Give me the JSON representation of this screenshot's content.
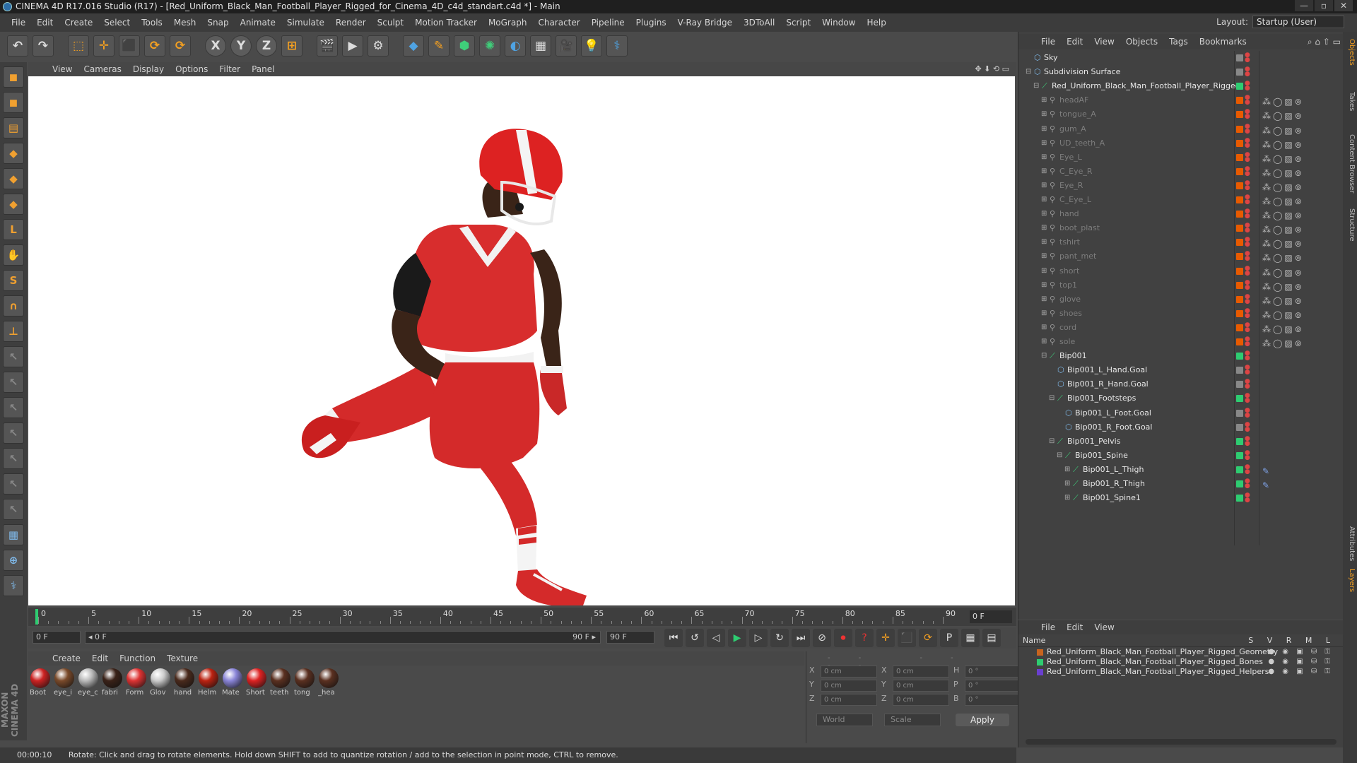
{
  "window": {
    "title": "CINEMA 4D R17.016 Studio (R17) - [Red_Uniform_Black_Man_Football_Player_Rigged_for_Cinema_4D_c4d_standart.c4d *] - Main",
    "min": "—",
    "max": "▫",
    "close": "✕"
  },
  "menubar": [
    "File",
    "Edit",
    "Create",
    "Select",
    "Tools",
    "Mesh",
    "Snap",
    "Animate",
    "Simulate",
    "Render",
    "Sculpt",
    "Motion Tracker",
    "MoGraph",
    "Character",
    "Pipeline",
    "Plugins",
    "V-Ray Bridge",
    "3DToAll",
    "Script",
    "Window",
    "Help"
  ],
  "layout": {
    "label": "Layout:",
    "value": "Startup (User)"
  },
  "toolbar": {
    "undo": "↶",
    "redo": "↷",
    "select": "⬚",
    "move": "✛",
    "scale": "⬛",
    "rotate": "⟳",
    "rotate2": "⟳",
    "x": "X",
    "y": "Y",
    "z": "Z",
    "coord": "⊞",
    "render1": "🎬",
    "render2": "▶",
    "render3": "⚙",
    "cube": "◆",
    "pen": "✎",
    "nurbs": "⬢",
    "array": "✺",
    "deformer": "◐",
    "floor": "▦",
    "camera": "🎥",
    "light": "💡",
    "python": "⚕"
  },
  "lefttools": [
    "◼",
    "◼",
    "▤",
    "◆",
    "◆",
    "◆",
    "L",
    "✋",
    "S",
    "∩",
    "⊥",
    "↖",
    "↖",
    "↖",
    "↖",
    "↖",
    "↖",
    "↖",
    "▦",
    "⊕",
    "⚕"
  ],
  "brand": "MAXON CINEMA 4D",
  "viewport_menu": [
    "View",
    "Cameras",
    "Display",
    "Options",
    "Filter",
    "Panel"
  ],
  "viewport_icons": "✥ ⬇ ⟲ ▭",
  "timeline": {
    "ticks": [
      "0",
      "5",
      "10",
      "15",
      "20",
      "25",
      "30",
      "35",
      "40",
      "45",
      "50",
      "55",
      "60",
      "65",
      "70",
      "75",
      "80",
      "85",
      "90"
    ],
    "frame_end": "0 F"
  },
  "transport": {
    "cur_frame": "0 F",
    "range_start": "◂ 0 F",
    "range_end": "90 F ▸",
    "end_frame": "90 F",
    "buttons": [
      "⏮",
      "↺",
      "◁",
      "▶",
      "▷",
      "↻",
      "⏭",
      "⊘",
      "⏺",
      "?",
      "✛",
      "⬛",
      "⟳",
      "P",
      "▦",
      "▤"
    ]
  },
  "material_menu": [
    "Create",
    "Edit",
    "Function",
    "Texture"
  ],
  "materials": [
    {
      "name": "Boot",
      "color": "#c22"
    },
    {
      "name": "eye_i",
      "color": "#7a4a2a"
    },
    {
      "name": "eye_c",
      "color": "#bbb"
    },
    {
      "name": "fabri",
      "color": "#3a2218"
    },
    {
      "name": "Form",
      "color": "#d33"
    },
    {
      "name": "Glov",
      "color": "#ccc"
    },
    {
      "name": "hand",
      "color": "#4a2a1c"
    },
    {
      "name": "Helm",
      "color": "#b21"
    },
    {
      "name": "Mate",
      "color": "#8a85d8"
    },
    {
      "name": "Short",
      "color": "#d22"
    },
    {
      "name": "teeth",
      "color": "#5a3020"
    },
    {
      "name": "tong",
      "color": "#5a3020"
    },
    {
      "name": "_hea",
      "color": "#5a3020"
    }
  ],
  "coords": {
    "header": "-- -- --",
    "rows": [
      {
        "a": "X",
        "av": "0 cm",
        "b": "X",
        "bv": "0 cm",
        "c": "H",
        "cv": "0 °"
      },
      {
        "a": "Y",
        "av": "0 cm",
        "b": "Y",
        "bv": "0 cm",
        "c": "P",
        "cv": "0 °"
      },
      {
        "a": "Z",
        "av": "0 cm",
        "b": "Z",
        "bv": "0 cm",
        "c": "B",
        "cv": "0 °"
      }
    ],
    "mode1": "World",
    "mode2": "Scale",
    "apply": "Apply"
  },
  "status": {
    "time": "00:00:10",
    "text": "Rotate: Click and drag to rotate elements. Hold down SHIFT to add to quantize rotation / add to the selection in point mode, CTRL to remove."
  },
  "object_menu": [
    "File",
    "Edit",
    "View",
    "Objects",
    "Tags",
    "Bookmarks"
  ],
  "object_icons": "⌕ ⌂ ⇧ ▭",
  "objects": [
    {
      "name": "Sky",
      "depth": 0,
      "dim": false,
      "tag": "#888",
      "exp": ""
    },
    {
      "name": "Subdivision Surface",
      "depth": 0,
      "dim": false,
      "tag": "#888",
      "exp": "⊟"
    },
    {
      "name": "Red_Uniform_Black_Man_Football_Player_Rigged",
      "depth": 1,
      "dim": false,
      "tag": "#2ecc71",
      "exp": "⊟"
    },
    {
      "name": "headAF",
      "depth": 2,
      "dim": true,
      "tag": "#e85a00",
      "exp": "⊞"
    },
    {
      "name": "tongue_A",
      "depth": 2,
      "dim": true,
      "tag": "#e85a00",
      "exp": "⊞"
    },
    {
      "name": "gum_A",
      "depth": 2,
      "dim": true,
      "tag": "#e85a00",
      "exp": "⊞"
    },
    {
      "name": "UD_teeth_A",
      "depth": 2,
      "dim": true,
      "tag": "#e85a00",
      "exp": "⊞"
    },
    {
      "name": "Eye_L",
      "depth": 2,
      "dim": true,
      "tag": "#e85a00",
      "exp": "⊞"
    },
    {
      "name": "C_Eye_R",
      "depth": 2,
      "dim": true,
      "tag": "#e85a00",
      "exp": "⊞"
    },
    {
      "name": "Eye_R",
      "depth": 2,
      "dim": true,
      "tag": "#e85a00",
      "exp": "⊞"
    },
    {
      "name": "C_Eye_L",
      "depth": 2,
      "dim": true,
      "tag": "#e85a00",
      "exp": "⊞"
    },
    {
      "name": "hand",
      "depth": 2,
      "dim": true,
      "tag": "#e85a00",
      "exp": "⊞"
    },
    {
      "name": "boot_plast",
      "depth": 2,
      "dim": true,
      "tag": "#e85a00",
      "exp": "⊞"
    },
    {
      "name": "tshirt",
      "depth": 2,
      "dim": true,
      "tag": "#e85a00",
      "exp": "⊞"
    },
    {
      "name": "pant_met",
      "depth": 2,
      "dim": true,
      "tag": "#e85a00",
      "exp": "⊞"
    },
    {
      "name": "short",
      "depth": 2,
      "dim": true,
      "tag": "#e85a00",
      "exp": "⊞"
    },
    {
      "name": "top1",
      "depth": 2,
      "dim": true,
      "tag": "#e85a00",
      "exp": "⊞"
    },
    {
      "name": "glove",
      "depth": 2,
      "dim": true,
      "tag": "#e85a00",
      "exp": "⊞"
    },
    {
      "name": "shoes",
      "depth": 2,
      "dim": true,
      "tag": "#e85a00",
      "exp": "⊞"
    },
    {
      "name": "cord",
      "depth": 2,
      "dim": true,
      "tag": "#e85a00",
      "exp": "⊞"
    },
    {
      "name": "sole",
      "depth": 2,
      "dim": true,
      "tag": "#e85a00",
      "exp": "⊞"
    },
    {
      "name": "Bip001",
      "depth": 2,
      "dim": false,
      "tag": "#2ecc71",
      "exp": "⊟"
    },
    {
      "name": "Bip001_L_Hand.Goal",
      "depth": 3,
      "dim": false,
      "tag": "#888",
      "exp": ""
    },
    {
      "name": "Bip001_R_Hand.Goal",
      "depth": 3,
      "dim": false,
      "tag": "#888",
      "exp": ""
    },
    {
      "name": "Bip001_Footsteps",
      "depth": 3,
      "dim": false,
      "tag": "#2ecc71",
      "exp": "⊟"
    },
    {
      "name": "Bip001_L_Foot.Goal",
      "depth": 4,
      "dim": false,
      "tag": "#888",
      "exp": ""
    },
    {
      "name": "Bip001_R_Foot.Goal",
      "depth": 4,
      "dim": false,
      "tag": "#888",
      "exp": ""
    },
    {
      "name": "Bip001_Pelvis",
      "depth": 3,
      "dim": false,
      "tag": "#2ecc71",
      "exp": "⊟"
    },
    {
      "name": "Bip001_Spine",
      "depth": 4,
      "dim": false,
      "tag": "#2ecc71",
      "exp": "⊟"
    },
    {
      "name": "Bip001_L_Thigh",
      "depth": 5,
      "dim": false,
      "tag": "#2ecc71",
      "exp": "⊞"
    },
    {
      "name": "Bip001_R_Thigh",
      "depth": 5,
      "dim": false,
      "tag": "#2ecc71",
      "exp": "⊞"
    },
    {
      "name": "Bip001_Spine1",
      "depth": 5,
      "dim": false,
      "tag": "#2ecc71",
      "exp": "⊞"
    }
  ],
  "side_tabs": [
    "Objects",
    "Takes",
    "Content Browser",
    "Structure",
    "Attributes",
    "Layers"
  ],
  "layer_menu": [
    "File",
    "Edit",
    "View"
  ],
  "layer_header": {
    "name": "Name",
    "cols": "S V R M L"
  },
  "layers": [
    {
      "name": "Red_Uniform_Black_Man_Football_Player_Rigged_Geometry",
      "color": "#c8641e"
    },
    {
      "name": "Red_Uniform_Black_Man_Football_Player_Rigged_Bones",
      "color": "#2ecc71"
    },
    {
      "name": "Red_Uniform_Black_Man_Football_Player_Rigged_Helpers",
      "color": "#6a3fd0"
    }
  ]
}
